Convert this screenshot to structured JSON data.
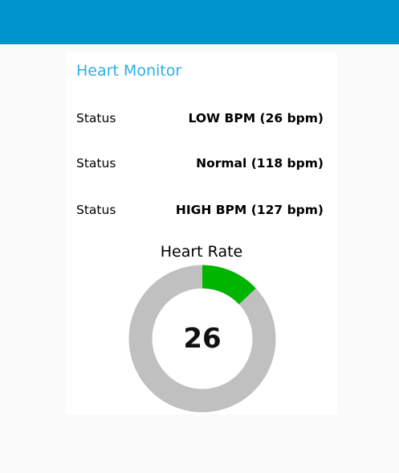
{
  "header": {
    "color": "#0094ce"
  },
  "card": {
    "title": "Heart Monitor",
    "title_color": "#2ab0e6"
  },
  "statuses": [
    {
      "label": "Status",
      "value": "LOW BPM (26 bpm)"
    },
    {
      "label": "Status",
      "value": "Normal (118 bpm)"
    },
    {
      "label": "Status",
      "value": "HIGH BPM (127 bpm)"
    }
  ],
  "gauge": {
    "title": "Heart Rate",
    "value": "26",
    "fraction": 0.13,
    "fill_color": "#00b500",
    "track_color": "#c0c0c0"
  }
}
